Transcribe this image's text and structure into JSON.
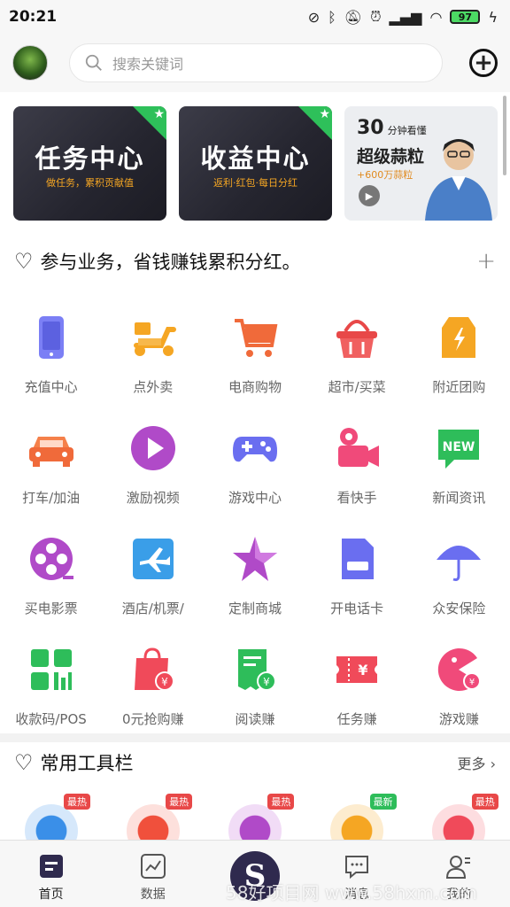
{
  "status": {
    "time": "20:21",
    "battery": "97"
  },
  "search": {
    "placeholder": "搜索关键词"
  },
  "banners": [
    {
      "title": "任务中心",
      "subtitle": "做任务，累积贡献值"
    },
    {
      "title": "收益中心",
      "subtitle": "返利·红包·每日分红"
    },
    {
      "num": "30",
      "unit": "分钟看懂",
      "title": "超级蒜粒",
      "subtitle": "+600万蒜粒"
    }
  ],
  "section1": {
    "title": "参与业务，省钱赚钱累积分红。"
  },
  "services": [
    {
      "label": "充值中心",
      "icon": "phone-icon"
    },
    {
      "label": "点外卖",
      "icon": "scooter-icon"
    },
    {
      "label": "电商购物",
      "icon": "cart-icon"
    },
    {
      "label": "超市/买菜",
      "icon": "basket-icon"
    },
    {
      "label": "附近团购",
      "icon": "coupon-bag-icon"
    },
    {
      "label": "打车/加油",
      "icon": "car-icon"
    },
    {
      "label": "激励视频",
      "icon": "play-icon"
    },
    {
      "label": "游戏中心",
      "icon": "gamepad-icon"
    },
    {
      "label": "看快手",
      "icon": "camera-icon"
    },
    {
      "label": "新闻资讯",
      "icon": "news-icon"
    },
    {
      "label": "买电影票",
      "icon": "film-reel-icon"
    },
    {
      "label": "酒店/机票/",
      "icon": "plane-icon"
    },
    {
      "label": "定制商城",
      "icon": "star-icon"
    },
    {
      "label": "开电话卡",
      "icon": "sim-card-icon"
    },
    {
      "label": "众安保险",
      "icon": "umbrella-icon"
    },
    {
      "label": "收款码/POS",
      "icon": "qrcode-icon"
    },
    {
      "label": "0元抢购赚",
      "icon": "shopping-bag-icon"
    },
    {
      "label": "阅读赚",
      "icon": "receipt-icon"
    },
    {
      "label": "任务赚",
      "icon": "ticket-icon"
    },
    {
      "label": "游戏赚",
      "icon": "pacman-icon"
    }
  ],
  "section2": {
    "title": "常用工具栏",
    "more": "更多"
  },
  "tools": [
    {
      "tag": "最热",
      "tag_color": "#e84848",
      "color": "#3a8fe8"
    },
    {
      "tag": "最热",
      "tag_color": "#e84848",
      "color": "#f0503c"
    },
    {
      "tag": "最热",
      "tag_color": "#e84848",
      "color": "#b04ac8"
    },
    {
      "tag": "最新",
      "tag_color": "#2ebd5a",
      "color": "#f5a623"
    },
    {
      "tag": "最热",
      "tag_color": "#e84848",
      "color": "#f04a5a"
    }
  ],
  "tabs": [
    {
      "label": "首页"
    },
    {
      "label": "数据"
    },
    {
      "label": ""
    },
    {
      "label": "消息"
    },
    {
      "label": "我的"
    }
  ],
  "center_tab": {
    "letter": "S"
  },
  "watermark": "58好项目网 www.58hxm.com"
}
